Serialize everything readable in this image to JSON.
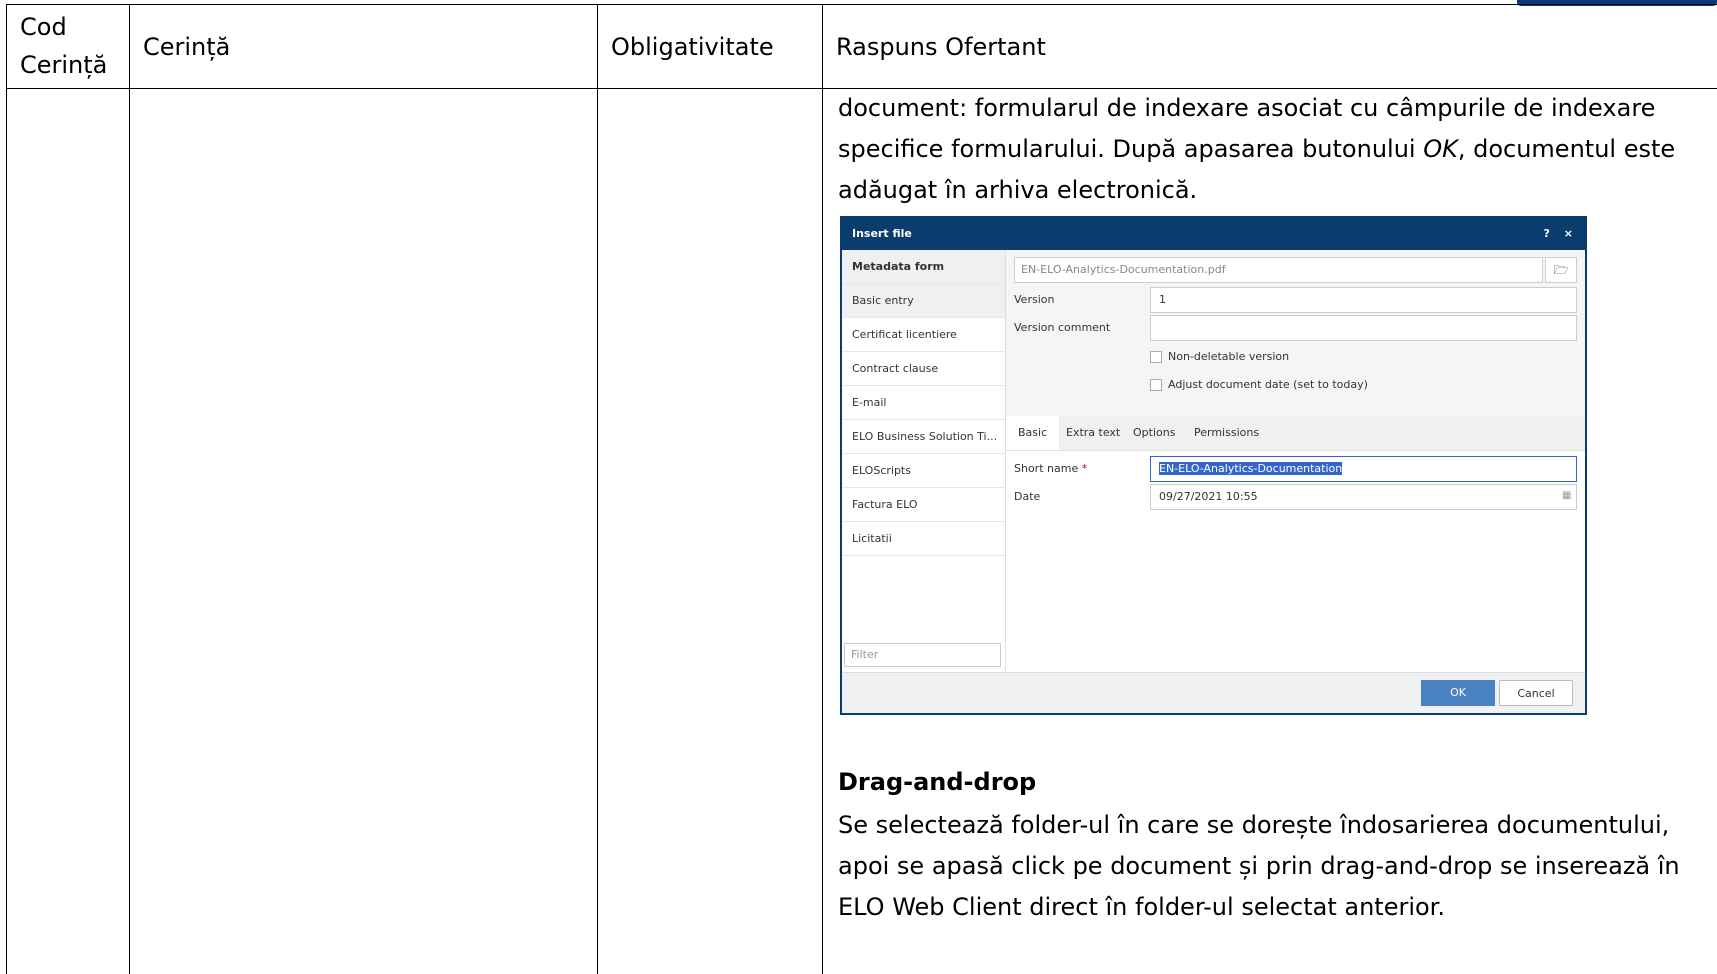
{
  "table": {
    "headers": {
      "code_line1": "Cod",
      "code_line2": "Cerință",
      "requirement": "Cerință",
      "mandatory": "Obligativitate",
      "response": "Raspuns Ofertant"
    }
  },
  "response": {
    "para1_line1": "document: formularul de indexare asociat cu câmpurile de indexare",
    "para1_line2_a": "specifice formularului. După apasarea butonului ",
    "para1_line2_em": "OK",
    "para1_line2_b": ", documentul este",
    "para1_line3": "adăugat în arhiva electronică.",
    "dragdrop_heading": "Drag-and-drop",
    "dragdrop_line1": "Se selectează folder-ul în care se dorește îndosarierea documentului,",
    "dragdrop_line2": "apoi se apasă click pe document și prin drag-and-drop se inserează în",
    "dragdrop_line3": "ELO Web Client direct în folder-ul selectat anterior."
  },
  "dialog": {
    "title": "Insert file",
    "help": "?",
    "close": "×",
    "sidebar": {
      "header": "Metadata form",
      "items": [
        "Basic entry",
        "Certificat licentiere",
        "Contract clause",
        "E-mail",
        "ELO Business Solution Ti...",
        "ELOScripts",
        "Factura ELO",
        "Licitatii"
      ],
      "filter_placeholder": "Filter"
    },
    "file_name": "EN-ELO-Analytics-Documentation.pdf",
    "version_label": "Version",
    "version_value": "1",
    "version_comment_label": "Version comment",
    "version_comment_value": "",
    "check_nondeletable": "Non-deletable version",
    "check_adjust_date": "Adjust document date (set to today)",
    "tabs": [
      "Basic",
      "Extra text",
      "Options",
      "Permissions"
    ],
    "short_name_label": "Short name",
    "short_name_required": "*",
    "short_name_value": "EN-ELO-Analytics-Documentation",
    "date_label": "Date",
    "date_value": "09/27/2021 10:55",
    "ok_label": "OK",
    "cancel_label": "Cancel"
  }
}
